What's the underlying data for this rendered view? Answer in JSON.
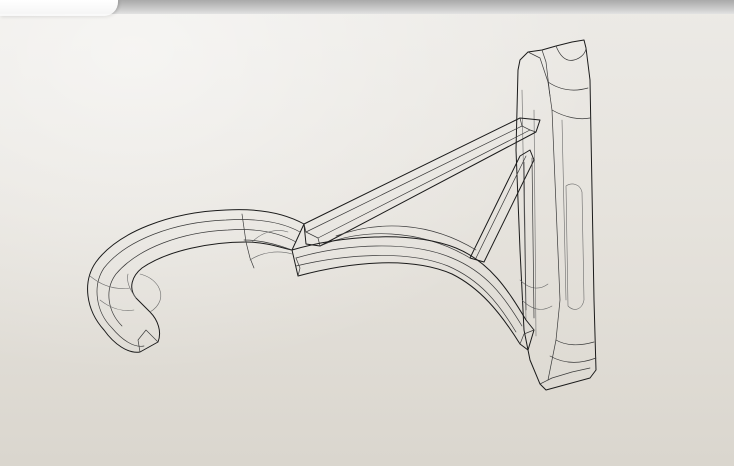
{
  "viewport": {
    "background_color": "#e6e3dd",
    "edge_color": "#1b1b1b",
    "display_style": "wireframe",
    "model_icon": "bracket-hook-model"
  }
}
